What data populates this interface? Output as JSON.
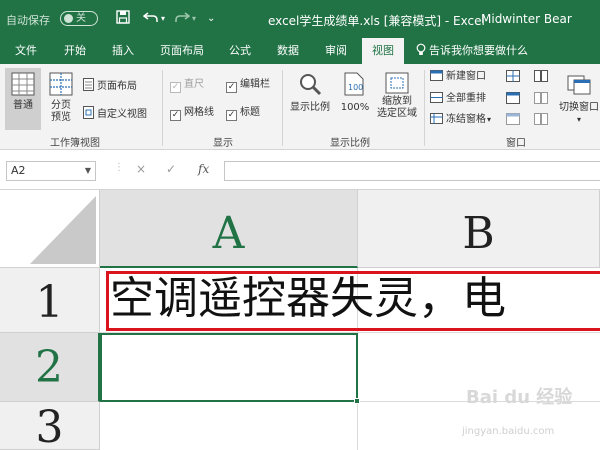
{
  "titlebar": {
    "autosave_label": "自动保存",
    "autosave_state": "关",
    "title": "excel学生成绩单.xls  [兼容模式] - Excel",
    "user": "Midwinter Bear"
  },
  "tabs": [
    {
      "label": "文件"
    },
    {
      "label": "开始"
    },
    {
      "label": "插入"
    },
    {
      "label": "页面布局"
    },
    {
      "label": "公式"
    },
    {
      "label": "数据"
    },
    {
      "label": "审阅"
    },
    {
      "label": "视图"
    }
  ],
  "active_tab": "视图",
  "tell_me": "告诉我你想要做什么",
  "ribbon": {
    "workbook_views": {
      "label": "工作簿视图",
      "normal": "普通",
      "page_break_l1": "分页",
      "page_break_l2": "预览",
      "page_layout": "页面布局",
      "custom_views": "自定义视图"
    },
    "show": {
      "label": "显示",
      "ruler": "直尺",
      "formula_bar": "编辑栏",
      "gridlines": "网格线",
      "headings": "标题"
    },
    "zoom": {
      "label": "显示比例",
      "zoom": "显示比例",
      "hundred": "100%",
      "zoom_sel_l1": "缩放到",
      "zoom_sel_l2": "选定区域"
    },
    "window": {
      "label": "窗口",
      "new_window": "新建窗口",
      "arrange_all": "全部重排",
      "freeze_panes": "冻结窗格",
      "switch_windows": "切换窗口"
    }
  },
  "formula_bar": {
    "name_box": "A2",
    "cancel": "×",
    "enter": "✓",
    "fx": "fx",
    "value": ""
  },
  "grid": {
    "columns": [
      "A",
      "B"
    ],
    "rows": [
      "1",
      "2",
      "3"
    ],
    "a1_text": "空调遥控器失灵，电",
    "selected_cell": "A2"
  },
  "watermark": {
    "brand": "Bai du 经验",
    "url": "jingyan.baidu.com"
  },
  "colors": {
    "excel_green": "#217346",
    "highlight_red": "#d9141c"
  }
}
